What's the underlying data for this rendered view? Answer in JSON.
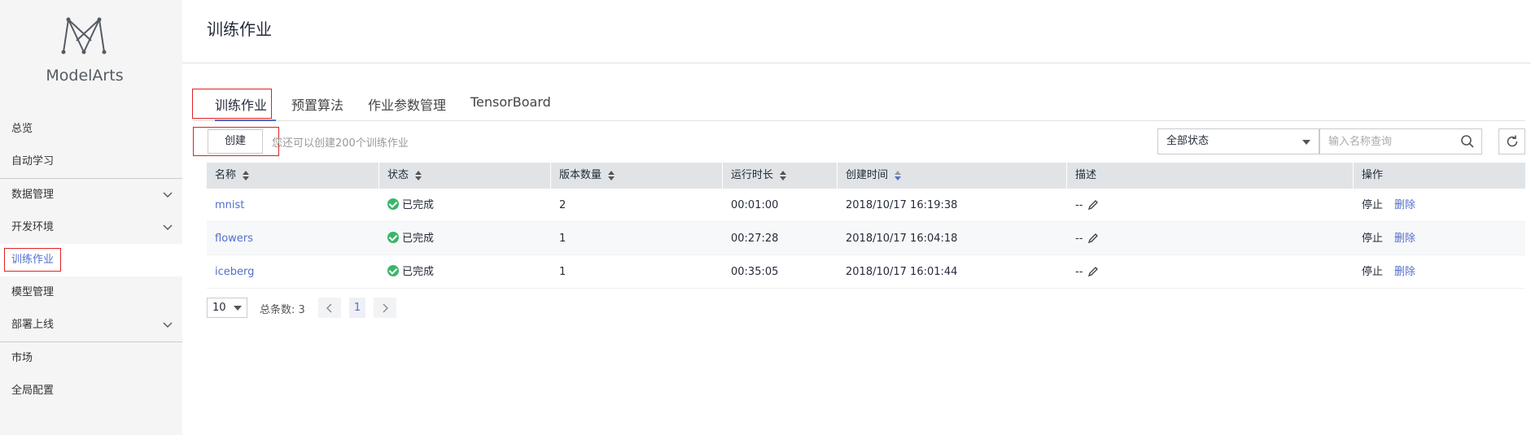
{
  "app": {
    "name": "ModelArts"
  },
  "sidebar": {
    "items": [
      {
        "label": "总览"
      },
      {
        "label": "自动学习"
      },
      {
        "label": "数据管理",
        "expandable": true
      },
      {
        "label": "开发环境",
        "expandable": true
      },
      {
        "label": "训练作业",
        "active": true
      },
      {
        "label": "模型管理"
      },
      {
        "label": "部署上线",
        "expandable": true
      },
      {
        "label": "市场"
      },
      {
        "label": "全局配置"
      }
    ]
  },
  "header": {
    "title": "训练作业"
  },
  "tabs": [
    {
      "label": "训练作业",
      "active": true
    },
    {
      "label": "预置算法"
    },
    {
      "label": "作业参数管理"
    },
    {
      "label": "TensorBoard"
    }
  ],
  "toolbar": {
    "create_label": "创建",
    "quota_text": "您还可以创建200个训练作业",
    "status_filter": "全部状态",
    "search_placeholder": "输入名称查询"
  },
  "table": {
    "columns": [
      "名称",
      "状态",
      "版本数量",
      "运行时长",
      "创建时间",
      "描述",
      "操作"
    ],
    "rows": [
      {
        "name": "mnist",
        "status": "已完成",
        "versions": "2",
        "duration": "00:01:00",
        "created": "2018/10/17 16:19:38",
        "desc": "--",
        "op_stop": "停止",
        "op_delete": "删除"
      },
      {
        "name": "flowers",
        "status": "已完成",
        "versions": "1",
        "duration": "00:27:28",
        "created": "2018/10/17 16:04:18",
        "desc": "--",
        "op_stop": "停止",
        "op_delete": "删除"
      },
      {
        "name": "iceberg",
        "status": "已完成",
        "versions": "1",
        "duration": "00:35:05",
        "created": "2018/10/17 16:01:44",
        "desc": "--",
        "op_stop": "停止",
        "op_delete": "删除"
      }
    ]
  },
  "pagination": {
    "page_size": "10",
    "total_text": "总条数: 3",
    "current_page": "1"
  },
  "colors": {
    "accent": "#526ecc",
    "success": "#3bb56a",
    "highlight_box": "#e02020"
  }
}
